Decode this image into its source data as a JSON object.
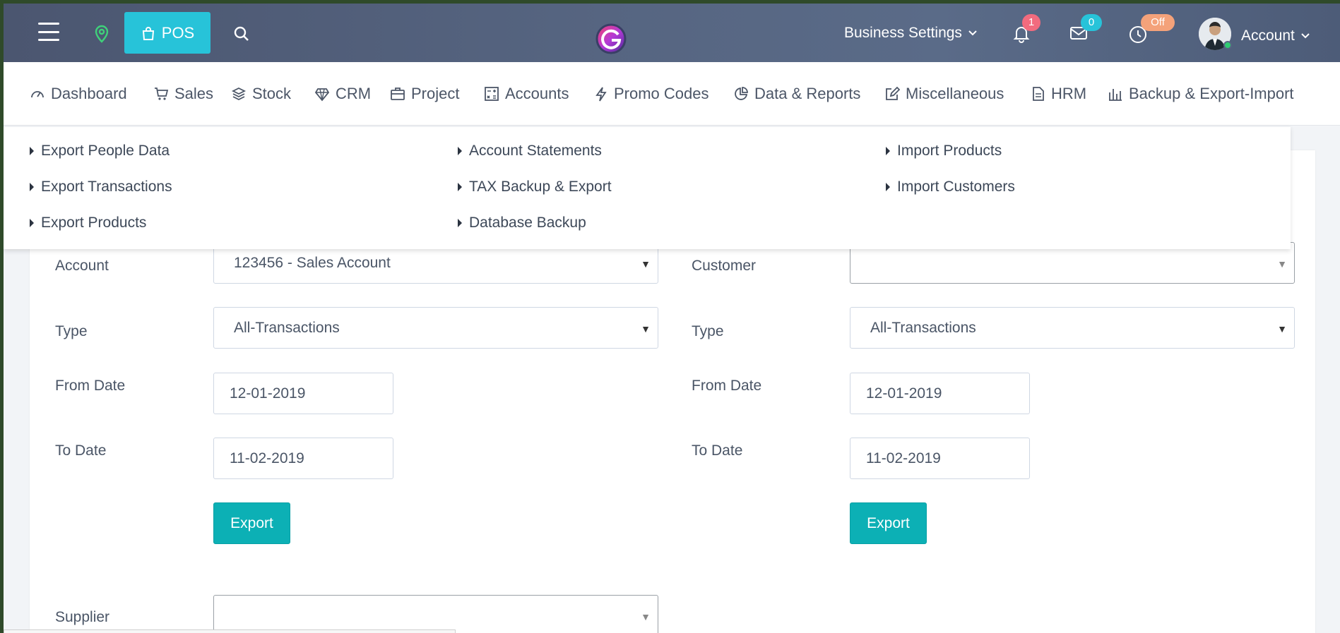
{
  "topbar": {
    "pos_label": "POS",
    "business_settings_label": "Business Settings",
    "notifications_count": "1",
    "messages_count": "0",
    "clock_status": "Off",
    "account_label": "Account"
  },
  "nav": {
    "items": [
      {
        "label": "Dashboard",
        "icon": "dashboard-icon"
      },
      {
        "label": "Sales",
        "icon": "cart-icon"
      },
      {
        "label": "Stock",
        "icon": "layers-icon"
      },
      {
        "label": "CRM",
        "icon": "diamond-icon"
      },
      {
        "label": "Project",
        "icon": "briefcase-icon"
      },
      {
        "label": "Accounts",
        "icon": "calculator-icon"
      },
      {
        "label": "Promo Codes",
        "icon": "bolt-icon"
      },
      {
        "label": "Data & Reports",
        "icon": "pie-icon"
      },
      {
        "label": "Miscellaneous",
        "icon": "edit-icon"
      },
      {
        "label": "HRM",
        "icon": "document-icon"
      },
      {
        "label": "Backup & Export-Import",
        "icon": "bar-chart-icon"
      }
    ]
  },
  "dropdown": {
    "col1": [
      "Export People Data",
      "Export Transactions",
      "Export Products"
    ],
    "col2": [
      "Account Statements",
      "TAX Backup & Export",
      "Database Backup"
    ],
    "col3": [
      "Import Products",
      "Import Customers"
    ]
  },
  "left_form": {
    "account_label": "Account",
    "account_value": "123456 - Sales Account",
    "type_label": "Type",
    "type_value": "All-Transactions",
    "from_label": "From Date",
    "from_value": "12-01-2019",
    "to_label": "To Date",
    "to_value": "11-02-2019",
    "export_label": "Export",
    "supplier_label": "Supplier",
    "supplier_value": ""
  },
  "right_form": {
    "customer_label": "Customer",
    "customer_value": "",
    "type_label": "Type",
    "type_value": "All-Transactions",
    "from_label": "From Date",
    "from_value": "12-01-2019",
    "to_label": "To Date",
    "to_value": "11-02-2019",
    "export_label": "Export"
  },
  "colors": {
    "accent": "#27c3d9",
    "button": "#0cb0b5",
    "badge_red": "#f26b7e",
    "badge_orange": "#f4a27a"
  }
}
